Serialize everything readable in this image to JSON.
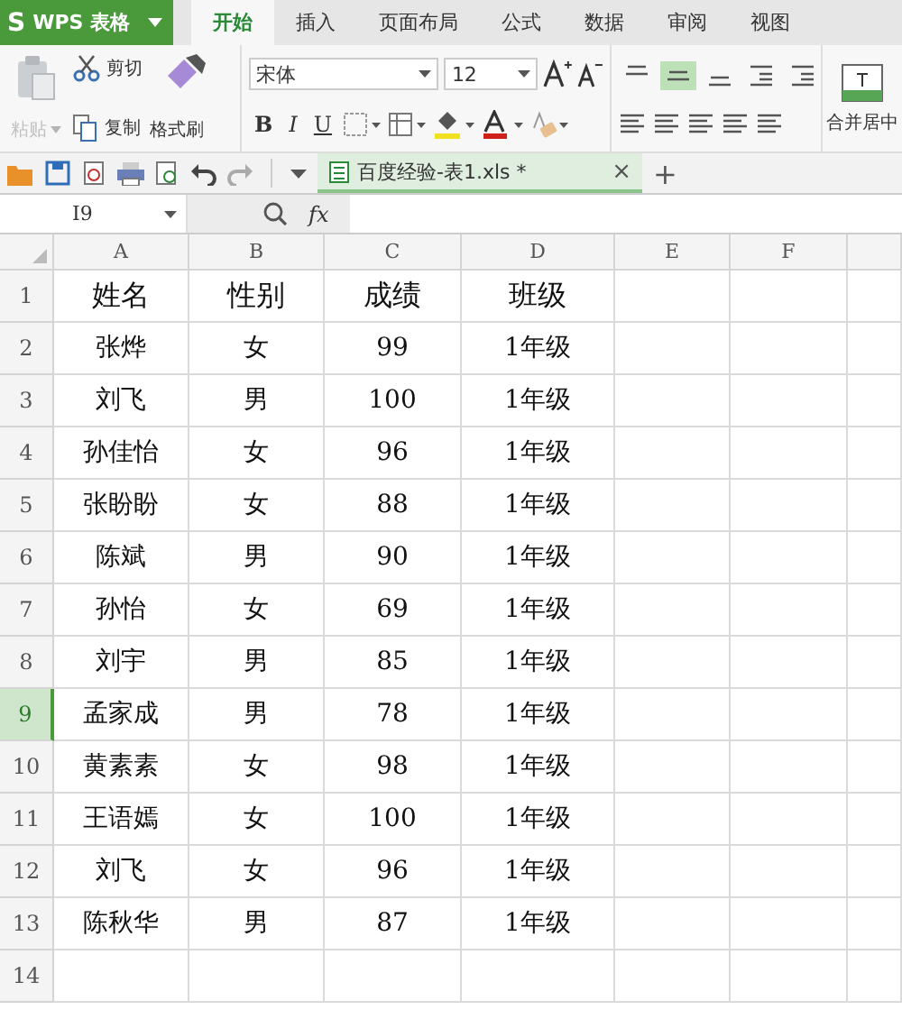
{
  "app": {
    "logo": "S",
    "title": "WPS 表格"
  },
  "tabs": [
    {
      "label": "开始",
      "selected": true
    },
    {
      "label": "插入",
      "selected": false
    },
    {
      "label": "页面布局",
      "selected": false
    },
    {
      "label": "公式",
      "selected": false
    },
    {
      "label": "数据",
      "selected": false
    },
    {
      "label": "审阅",
      "selected": false
    },
    {
      "label": "视图",
      "selected": false
    }
  ],
  "ribbon": {
    "paste": {
      "label": "粘贴",
      "disabled": true
    },
    "cut": "剪切",
    "copy": "复制",
    "format_painter": "格式刷",
    "font_name": "宋体",
    "font_size": "12",
    "format_buttons": [
      "B",
      "I",
      "U"
    ],
    "align_buttons": [
      {
        "selected": false
      },
      {
        "selected": true
      },
      {
        "selected": false
      },
      {
        "selected": false
      },
      {
        "selected": false
      }
    ],
    "merge": "合并居中"
  },
  "document_tab": {
    "title": "百度经验-表1.xls *",
    "close": "×",
    "new": "+"
  },
  "formula_bar": {
    "name_box": "I9",
    "fx": "fx"
  },
  "table": {
    "columns": [
      "A",
      "B",
      "C",
      "D",
      "E",
      "F"
    ],
    "rows": [
      {
        "number": "1",
        "kind": "header",
        "selected": false,
        "cells": [
          "姓名",
          "性别",
          "成绩",
          "班级"
        ]
      },
      {
        "number": "2",
        "kind": "data",
        "selected": false,
        "cells": [
          "张烨",
          "女",
          "99",
          "1年级"
        ]
      },
      {
        "number": "3",
        "kind": "data",
        "selected": false,
        "cells": [
          "刘飞",
          "男",
          "100",
          "1年级"
        ]
      },
      {
        "number": "4",
        "kind": "data",
        "selected": false,
        "cells": [
          "孙佳怡",
          "女",
          "96",
          "1年级"
        ]
      },
      {
        "number": "5",
        "kind": "data",
        "selected": false,
        "cells": [
          "张盼盼",
          "女",
          "88",
          "1年级"
        ]
      },
      {
        "number": "6",
        "kind": "data",
        "selected": false,
        "cells": [
          "陈斌",
          "男",
          "90",
          "1年级"
        ]
      },
      {
        "number": "7",
        "kind": "data",
        "selected": false,
        "cells": [
          "孙怡",
          "女",
          "69",
          "1年级"
        ]
      },
      {
        "number": "8",
        "kind": "data",
        "selected": false,
        "cells": [
          "刘宇",
          "男",
          "85",
          "1年级"
        ]
      },
      {
        "number": "9",
        "kind": "data",
        "selected": true,
        "cells": [
          "孟家成",
          "男",
          "78",
          "1年级"
        ]
      },
      {
        "number": "10",
        "kind": "data",
        "selected": false,
        "cells": [
          "黄素素",
          "女",
          "98",
          "1年级"
        ]
      },
      {
        "number": "11",
        "kind": "data",
        "selected": false,
        "cells": [
          "王语嫣",
          "女",
          "100",
          "1年级"
        ]
      },
      {
        "number": "12",
        "kind": "data",
        "selected": false,
        "cells": [
          "刘飞",
          "女",
          "96",
          "1年级"
        ]
      },
      {
        "number": "13",
        "kind": "data",
        "selected": false,
        "cells": [
          "陈秋华",
          "男",
          "87",
          "1年级"
        ]
      },
      {
        "number": "14",
        "kind": "data",
        "selected": false,
        "cells": []
      }
    ]
  }
}
